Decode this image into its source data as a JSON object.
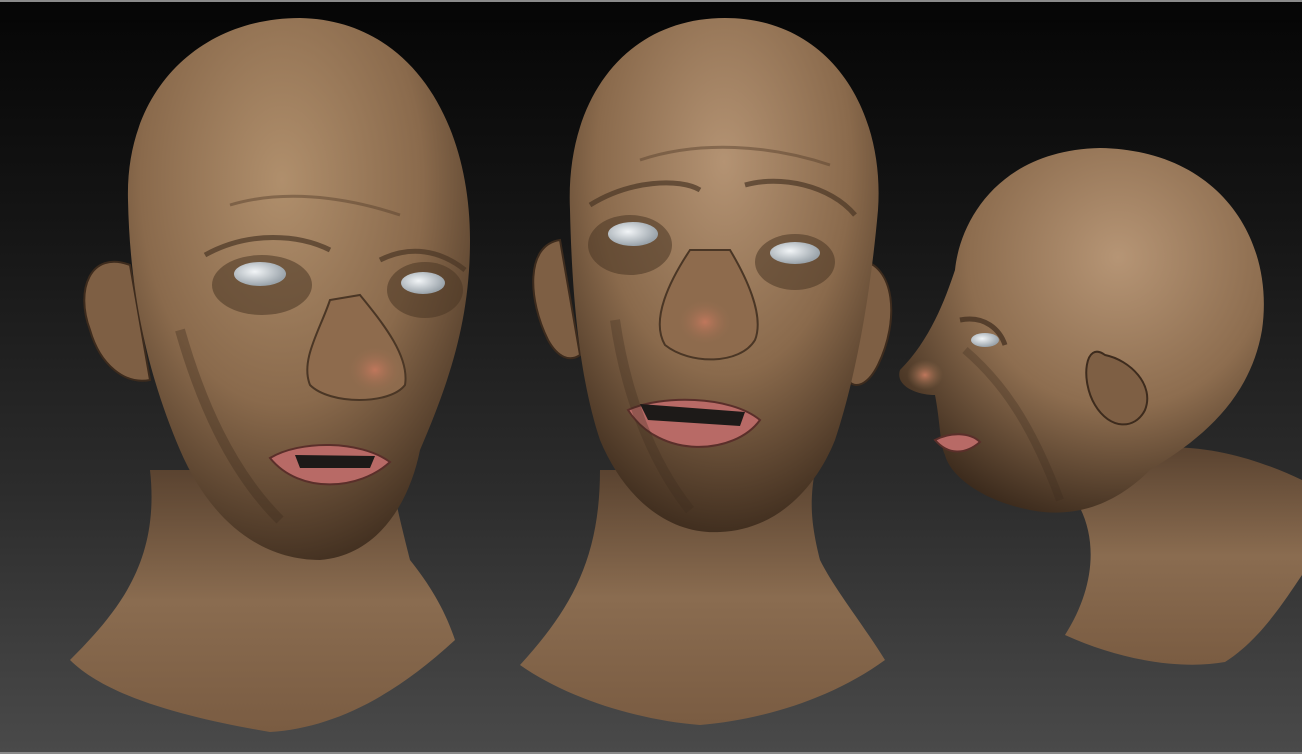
{
  "viewport": {
    "background_top": "#050505",
    "background_bottom": "#4a4a4a",
    "frame_color": "#8a8a8a"
  },
  "model": {
    "skin_color": "#8a6a4c",
    "skin_shadow": "#3b2a1c",
    "skin_highlight": "#b08f6c",
    "lip_color": "#b86a66",
    "eye_color": "#d7dde2",
    "views": [
      "front-left",
      "front",
      "side-profile"
    ]
  }
}
